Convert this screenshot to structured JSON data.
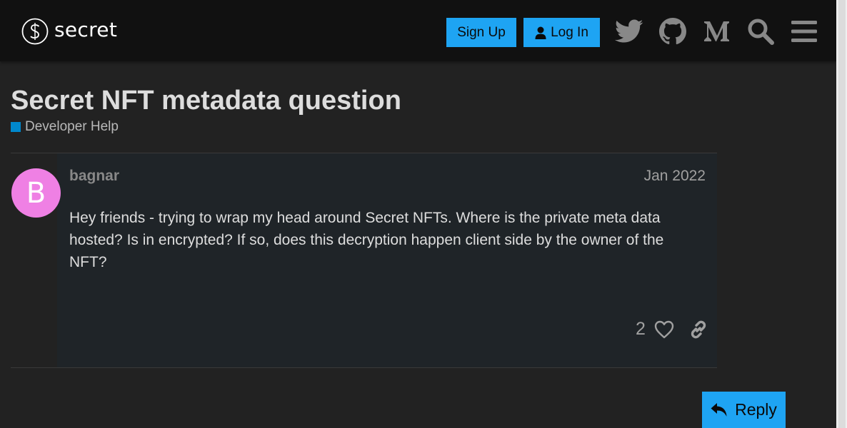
{
  "header": {
    "logo_text": "secret",
    "signup_label": "Sign Up",
    "login_label": "Log In",
    "icons": [
      "twitter-icon",
      "github-icon",
      "medium-icon",
      "search-icon",
      "hamburger-menu-icon"
    ]
  },
  "topic": {
    "title": "Secret NFT metadata question",
    "category": "Developer Help",
    "category_color": "#0088cc"
  },
  "post": {
    "avatar_letter": "B",
    "avatar_color": "#ef80e4",
    "username": "bagnar",
    "date": "Jan 2022",
    "body": "Hey friends - trying to wrap my head around Secret NFTs. Where is the private meta data hosted? Is in encrypted? If so, does this decryption happen client side by the owner of the NFT?",
    "like_count": "2"
  },
  "footer": {
    "reply_label": "Reply"
  },
  "colors": {
    "accent": "#1ea4f3",
    "background": "#222222",
    "header": "#111111"
  }
}
